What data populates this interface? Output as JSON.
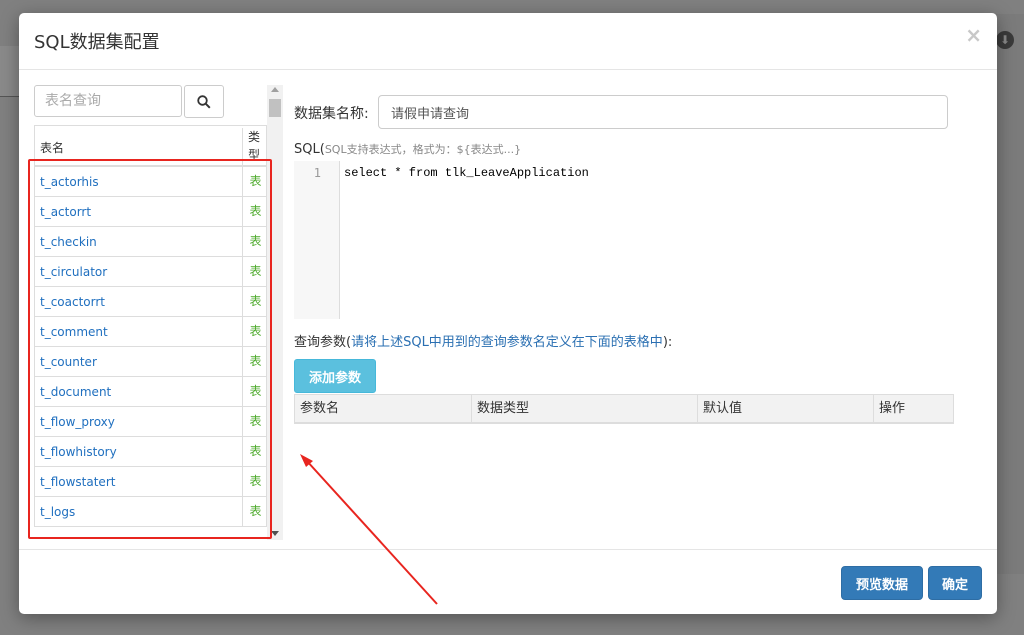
{
  "modal": {
    "title": "SQL数据集配置",
    "close": "×"
  },
  "left_panel": {
    "search_placeholder": "表名查询",
    "columns": {
      "name": "表名",
      "type": "类型"
    },
    "rows": [
      {
        "name": "t_actorhis",
        "type": "表"
      },
      {
        "name": "t_actorrt",
        "type": "表"
      },
      {
        "name": "t_checkin",
        "type": "表"
      },
      {
        "name": "t_circulator",
        "type": "表"
      },
      {
        "name": "t_coactorrt",
        "type": "表"
      },
      {
        "name": "t_comment",
        "type": "表"
      },
      {
        "name": "t_counter",
        "type": "表"
      },
      {
        "name": "t_document",
        "type": "表"
      },
      {
        "name": "t_flow_proxy",
        "type": "表"
      },
      {
        "name": "t_flowhistory",
        "type": "表"
      },
      {
        "name": "t_flowstatert",
        "type": "表"
      },
      {
        "name": "t_logs",
        "type": "表"
      }
    ]
  },
  "right_panel": {
    "dataset_name_label": "数据集名称:",
    "dataset_name_value": "请假申请查询",
    "sql_label": "SQL(",
    "sql_hint": "SQL支持表达式，格式为：${表达式...}",
    "editor": {
      "line_number": "1",
      "code": "select * from tlk_LeaveApplication"
    },
    "params_label": "查询参数(",
    "params_note": "请将上述SQL中用到的查询参数名定义在下面的表格中",
    "params_label_end": "):",
    "add_param_button": "添加参数",
    "param_columns": [
      "参数名",
      "数据类型",
      "默认值",
      "操作"
    ]
  },
  "footer": {
    "preview_button": "预览数据",
    "confirm_button": "确定"
  },
  "colors": {
    "primary": "#337ab7",
    "info": "#5bc0de",
    "link": "#1f6fbf",
    "type_green": "#4caa2b",
    "annotation_red": "#e8251f"
  }
}
